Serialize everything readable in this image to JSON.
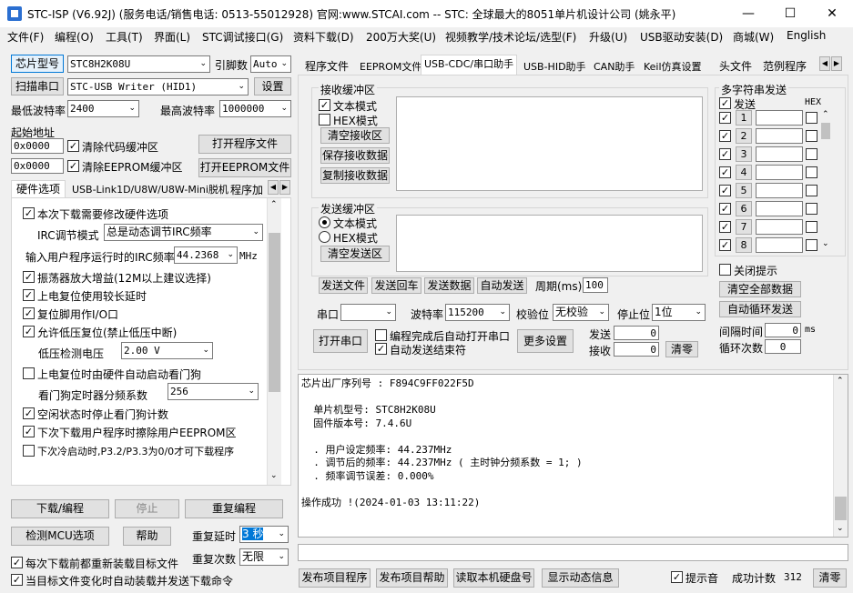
{
  "window": {
    "title": "STC-ISP (V6.92J) (服务电话/销售电话: 0513-55012928) 官网:www.STCAI.com  -- STC: 全球最大的8051单片机设计公司 (姚永平)"
  },
  "menu": [
    "文件(F)",
    "编程(O)",
    "工具(T)",
    "界面(L)",
    "STC调试接口(G)",
    "资料下载(D)",
    "200万大奖(U)",
    "视频教学/技术论坛/选型(F)",
    "升级(U)",
    "USB驱动安装(D)",
    "商城(W)",
    "English"
  ],
  "left": {
    "chip_model_btn": "芯片型号",
    "chip_model": "STC8H2K08U",
    "pins_label": "引脚数",
    "pins": "Auto",
    "scan_port_btn": "扫描串口",
    "port": "STC-USB Writer (HID1)",
    "settings_btn": "设置",
    "min_baud_label": "最低波特率",
    "min_baud": "2400",
    "max_baud_label": "最高波特率",
    "max_baud": "1000000",
    "start_addr_label": "起始地址",
    "addr1": "0x0000",
    "clear_code_label": "清除代码缓冲区",
    "open_prog_btn": "打开程序文件",
    "addr2": "0x0000",
    "clear_eeprom_label": "清除EEPROM缓冲区",
    "open_eeprom_btn": "打开EEPROM文件",
    "tabs": [
      "硬件选项",
      "USB-Link1D/U8W/U8W-Mini脱机",
      "程序加"
    ],
    "options": {
      "opt1": "本次下载需要修改硬件选项",
      "irc_mode_label": "IRC调节模式",
      "irc_mode": "总是动态调节IRC频率",
      "irc_freq_label": "输入用户程序运行时的IRC频率",
      "irc_freq": "44.2368",
      "irc_unit": "MHz",
      "opt2": "振荡器放大增益(12M以上建议选择)",
      "opt3": "上电复位使用较长延时",
      "opt4": "复位脚用作I/O口",
      "opt5": "允许低压复位(禁止低压中断)",
      "lv_label": "低压检测电压",
      "lv": "2.00 V",
      "opt6": "上电复位时由硬件自动启动看门狗",
      "wdt_label": "看门狗定时器分频系数",
      "wdt": "256",
      "opt7": "空闲状态时停止看门狗计数",
      "opt8": "下次下载用户程序时擦除用户EEPROM区",
      "opt9": "下次冷启动时,P3.2/P3.3为0/0才可下载程序"
    },
    "download_btn": "下载/编程",
    "stop_btn": "停止",
    "reprogram_btn": "重复编程",
    "check_mcu_btn": "检测MCU选项",
    "help_btn": "帮助",
    "repeat_delay_label": "重复延时",
    "repeat_delay": "3 秒",
    "repeat_count_label": "重复次数",
    "repeat_count": "无限",
    "reload_label": "每次下载前都重新装载目标文件",
    "autosend_label": "当目标文件变化时自动装载并发送下载命令"
  },
  "right": {
    "tabs": [
      "程序文件",
      "EEPROM文件",
      "USB-CDC/串口助手",
      "USB-HID助手",
      "CAN助手",
      "Keil仿真设置",
      "头文件",
      "范例程序"
    ],
    "recv": {
      "group": "接收缓冲区",
      "text_mode": "文本模式",
      "hex_mode": "HEX模式",
      "clear_btn": "清空接收区",
      "save_btn": "保存接收数据",
      "copy_btn": "复制接收数据"
    },
    "send": {
      "group": "发送缓冲区",
      "text_mode": "文本模式",
      "hex_mode": "HEX模式",
      "clear_btn": "清空发送区",
      "send_file_btn": "发送文件",
      "send_enter_btn": "发送回车",
      "send_data_btn": "发送数据",
      "auto_send_btn": "自动发送",
      "period_label": "周期(ms)",
      "period": "100"
    },
    "multi": {
      "group": "多字符串发送",
      "send_label": "发送",
      "hex_label": "HEX",
      "rows": [
        "1",
        "2",
        "3",
        "4",
        "5",
        "6",
        "7",
        "8"
      ],
      "close_tips": "关闭提示",
      "clear_all_btn": "清空全部数据",
      "auto_loop_btn": "自动循环发送",
      "interval_label": "间隔时间",
      "interval": "0",
      "interval_unit": "ms",
      "loop_label": "循环次数",
      "loop": "0"
    },
    "port_row": {
      "port_label": "串口",
      "baud_label": "波特率",
      "baud": "115200",
      "parity_label": "校验位",
      "parity": "无校验",
      "stop_label": "停止位",
      "stop": "1位"
    },
    "open_port_btn": "打开串口",
    "auto_open_label": "编程完成后自动打开串口",
    "auto_end_label": "自动发送结束符",
    "more_btn": "更多设置",
    "sent_label": "发送",
    "sent": "0",
    "recv_label": "接收",
    "recv_count": "0",
    "clear_btn": "清零",
    "log": [
      "芯片出厂序列号 : F894C9FF022F5D",
      "",
      "  单片机型号: STC8H2K08U",
      "  固件版本号: 7.4.6U",
      "",
      "  . 用户设定频率: 44.237MHz",
      "  . 调节后的频率: 44.237MHz ( 主时钟分频系数 = 1; )",
      "  . 频率调节误差: 0.000%",
      "",
      "操作成功 !(2024-01-03 13:11:22)"
    ],
    "bottom": {
      "publish_btn": "发布项目程序",
      "publish_help_btn": "发布项目帮助",
      "read_disk_btn": "读取本机硬盘号",
      "dyn_info_btn": "显示动态信息",
      "beep_label": "提示音",
      "success_label": "成功计数",
      "success": "312",
      "clear_btn": "清零"
    }
  }
}
